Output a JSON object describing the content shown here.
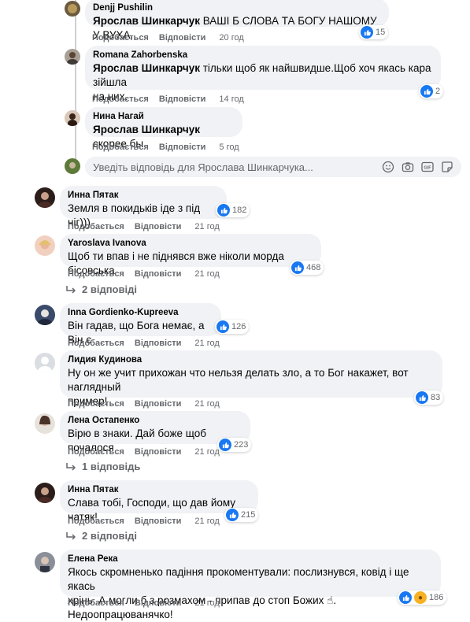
{
  "comments": [
    {
      "author": "Denjj Pushilin",
      "mention": "Ярослав Шинкарчук",
      "text": " ВАШІ Б СЛОВА ТА БОГУ НАШОМУ У ВУХА.",
      "like": "Подобається",
      "reply": "Відповісти",
      "time": "20 год",
      "reactions": "15"
    },
    {
      "author": "Romana Zahorbenska",
      "mention": "Ярослав Шинкарчук",
      "text_line1": " тільки щоб як найшвидше.Щоб хоч якась кара зійшла",
      "text_line2": "на них.",
      "like": "Подобається",
      "reply": "Відповісти",
      "time": "14 год",
      "reactions": "2"
    },
    {
      "author": "Нина Нагай",
      "mention": "Ярослав Шинкарчук",
      "text": " скорее бы",
      "like": "Подобається",
      "reply": "Відповісти",
      "time": "5 год"
    },
    {
      "author": "Инна Пятак",
      "text": "Земля в покидьків іде з під ніг)))",
      "like": "Подобається",
      "reply": "Відповісти",
      "time": "21 год",
      "reactions": "182"
    },
    {
      "author": "Yaroslava Ivanova",
      "text": "Щоб ти впав і не піднявся вже ніколи морда бісовська",
      "like": "Подобається",
      "reply": "Відповісти",
      "time": "21 год",
      "reactions": "468",
      "replies": "2 відповіді"
    },
    {
      "author": "Inna Gordienko-Kupreeva",
      "text": "Він гадав, що Бога немає, а Він є",
      "like": "Подобається",
      "reply": "Відповісти",
      "time": "21 год",
      "reactions": "126"
    },
    {
      "author": "Лидия Кудинова",
      "text_line1": "Ну он же учит прихожан что нельзя делать зло, а то Бог накажет, вот наглядный",
      "text_line2": "пример!",
      "like": "Подобається",
      "reply": "Відповісти",
      "time": "21 год",
      "reactions": "83"
    },
    {
      "author": "Лена Остапенко",
      "text": "Вірю в знаки. Дай боже щоб почалося",
      "like": "Подобається",
      "reply": "Відповісти",
      "time": "21 год",
      "reactions": "223",
      "replies": "1 відповідь"
    },
    {
      "author": "Инна Пятак",
      "text": "Слава тобі, Господи, що дав йому натяк!",
      "like": "Подобається",
      "reply": "Відповісти",
      "time": "21 год",
      "reactions": "215",
      "replies": "2 відповіді"
    },
    {
      "author": "Елена Река",
      "text_line1": "Якось скромненько падіння прокоментували: послизнувся, ковід і ще якась",
      "text_line2": "хрінь. А могли б з розмахом - припав до стоп Божих ☝. Недоопрацюванячко!",
      "like": "Подобається",
      "reply": "Відповісти",
      "time": "21 год",
      "reactions": "186"
    }
  ],
  "reply_box": {
    "placeholder": "Уведіть відповідь для Ярослава Шинкарчука..."
  },
  "icons": [
    "emoji-icon",
    "camera-icon",
    "gif-icon",
    "sticker-icon",
    "like-icon",
    "haha-icon",
    "reply-arrow-icon"
  ],
  "colors": {
    "like_blue": "#1877f2",
    "bubble_bg": "#f0f2f5",
    "meta_gray": "#65676b"
  }
}
